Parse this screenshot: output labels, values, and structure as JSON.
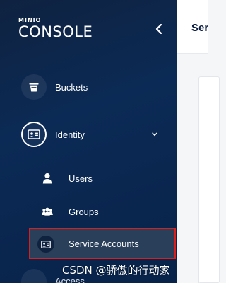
{
  "logo": {
    "top": "MINIO",
    "main": "CONSOLE"
  },
  "sidebar": {
    "items": [
      {
        "label": "Buckets"
      },
      {
        "label": "Identity"
      }
    ],
    "identity_sub": [
      {
        "label": "Users"
      },
      {
        "label": "Groups"
      },
      {
        "label": "Service Accounts",
        "active": true
      }
    ],
    "partial_item": {
      "label": "Access"
    }
  },
  "main": {
    "title": "Ser"
  },
  "watermark": "CSDN @骄傲的行动家",
  "colors": {
    "sidebar_bg": "#0b2a55",
    "highlight_border": "#d91e1e",
    "active_item_bg": "#2a3f5a",
    "title_color": "#081c42"
  },
  "icons": {
    "collapse": "chevron-left-icon",
    "buckets": "bucket-icon",
    "identity": "id-card-icon",
    "identity_expand": "chevron-down-icon",
    "users": "user-icon",
    "groups": "group-icon",
    "service_accounts": "service-account-icon"
  }
}
